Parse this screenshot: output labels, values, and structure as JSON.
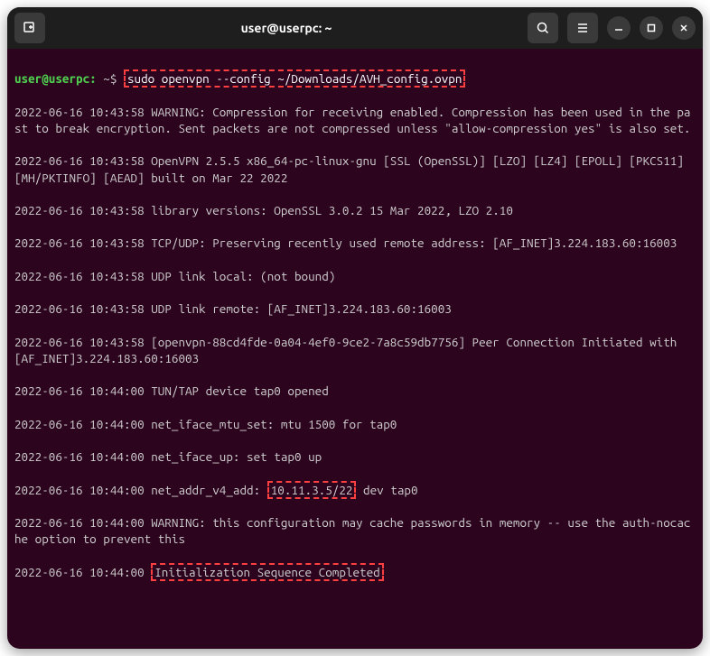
{
  "titlebar": {
    "title": "user@userpc: ~"
  },
  "prompt": {
    "user_host": "user@userpc",
    "path": ":",
    "separator": " ~$ ",
    "command": "sudo openvpn --config ~/Downloads/AVH_config.ovpn"
  },
  "lines": {
    "l1": "2022-06-16 10:43:58 WARNING: Compression for receiving enabled. Compression has been used in the past to break encryption. Sent packets are not compressed unless \"allow-compression yes\" is also set.",
    "l2": "2022-06-16 10:43:58 OpenVPN 2.5.5 x86_64-pc-linux-gnu [SSL (OpenSSL)] [LZO] [LZ4] [EPOLL] [PKCS11] [MH/PKTINFO] [AEAD] built on Mar 22 2022",
    "l3": "2022-06-16 10:43:58 library versions: OpenSSL 3.0.2 15 Mar 2022, LZO 2.10",
    "l4": "2022-06-16 10:43:58 TCP/UDP: Preserving recently used remote address: [AF_INET]3.224.183.60:16003",
    "l5": "2022-06-16 10:43:58 UDP link local: (not bound)",
    "l6": "2022-06-16 10:43:58 UDP link remote: [AF_INET]3.224.183.60:16003",
    "l7": "2022-06-16 10:43:58 [openvpn-88cd4fde-0a04-4ef0-9ce2-7a8c59db7756] Peer Connection Initiated with [AF_INET]3.224.183.60:16003",
    "l8": "2022-06-16 10:44:00 TUN/TAP device tap0 opened",
    "l9": "2022-06-16 10:44:00 net_iface_mtu_set: mtu 1500 for tap0",
    "l10": "2022-06-16 10:44:00 net_iface_up: set tap0 up",
    "l11a": "2022-06-16 10:44:00 net_addr_v4_add: ",
    "l11b": "10.11.3.5/22",
    "l11c": " dev tap0",
    "l12": "2022-06-16 10:44:00 WARNING: this configuration may cache passwords in memory -- use the auth-nocache option to prevent this",
    "l13a": "2022-06-16 10:44:00 ",
    "l13b": "Initialization Sequence Completed"
  }
}
